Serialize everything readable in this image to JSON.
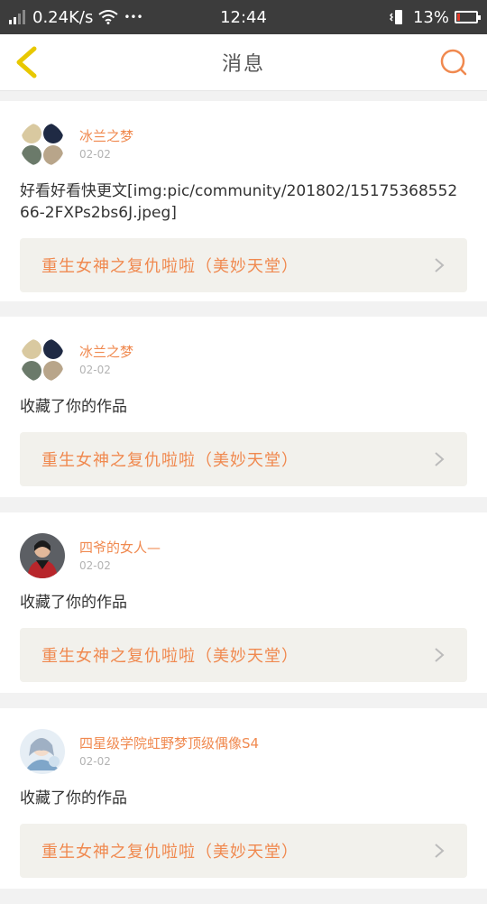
{
  "status_bar": {
    "network_speed": "0.24K/s",
    "more": "•••",
    "time": "12:44",
    "battery_percent": "13%",
    "battery_level": 0.13
  },
  "header": {
    "title": "消息"
  },
  "feed": [
    {
      "username": "冰兰之梦",
      "date": "02-02",
      "content": "好看好看快更文[img:pic/community/201802/1517536855266-2FXPs2bs6J.jpeg]",
      "work_title": "重生女神之复仇啦啦（美妙天堂）",
      "avatar": "avatar-collage"
    },
    {
      "username": "冰兰之梦",
      "date": "02-02",
      "content": "收藏了你的作品",
      "work_title": "重生女神之复仇啦啦（美妙天堂）",
      "avatar": "avatar-collage"
    },
    {
      "username": "四爷的女人—",
      "date": "02-02",
      "content": "收藏了你的作品",
      "work_title": "重生女神之复仇啦啦（美妙天堂）",
      "avatar": "avatar-photo"
    },
    {
      "username": "四星级学院虹野梦顶级偶像S4",
      "date": "02-02",
      "content": "收藏了你的作品",
      "work_title": "重生女神之复仇啦啦（美妙天堂）",
      "avatar": "avatar-anime"
    }
  ],
  "colors": {
    "accent": "#f0894f",
    "back_icon": "#e8c800",
    "card_link_bg": "#f2f1ec"
  },
  "icons": {
    "back": "chevron-left-icon",
    "search": "search-icon",
    "link_arrow": "chevron-right-icon"
  }
}
